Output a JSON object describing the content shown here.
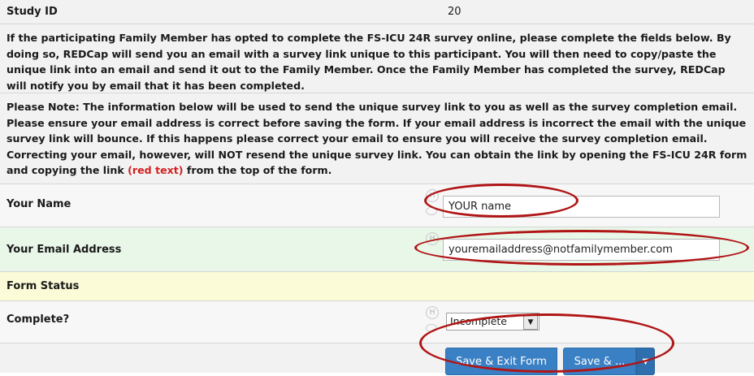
{
  "study_id": {
    "label": "Study ID",
    "value": "20"
  },
  "instructions": {
    "p1": "If the participating Family Member has opted to complete the FS-ICU 24R survey online, please complete the fields below. By doing so, REDCap will send you an email with a survey link unique to this participant. You will then need to copy/paste the unique link into an email and send it out to the Family Member. Once the Family Member has completed the survey, REDCap will notify you by email that it has been completed.",
    "p2_before": "Please Note: The information below will be used to send the unique survey link to you as well as the survey completion email. Please ensure your email address is correct before saving the form. If your email address is incorrect the email with the unique survey link will bounce. If this happens please correct your email to ensure you will receive the survey completion email. Correcting your email, however, will NOT resend the unique survey link. You can obtain the link by opening the FS-ICU 24R form and copying the link ",
    "p2_red": "(red text)",
    "p2_after": " from the top of the form."
  },
  "fields": {
    "name_label": "Your Name",
    "name_value": "YOUR name",
    "email_label": "Your Email Address",
    "email_value": "youremailaddress@notfamilymember.com"
  },
  "form_status": {
    "header": "Form Status",
    "complete_label": "Complete?",
    "complete_value": "Incomplete"
  },
  "buttons": {
    "save_exit": "Save & Exit Form",
    "save_more": "Save & ..."
  },
  "icons": {
    "history": "H",
    "caret": "▼"
  },
  "colors": {
    "annotation": "#b01515",
    "button": "#3a80c4",
    "highlight_red_text": "#d21f1f"
  }
}
